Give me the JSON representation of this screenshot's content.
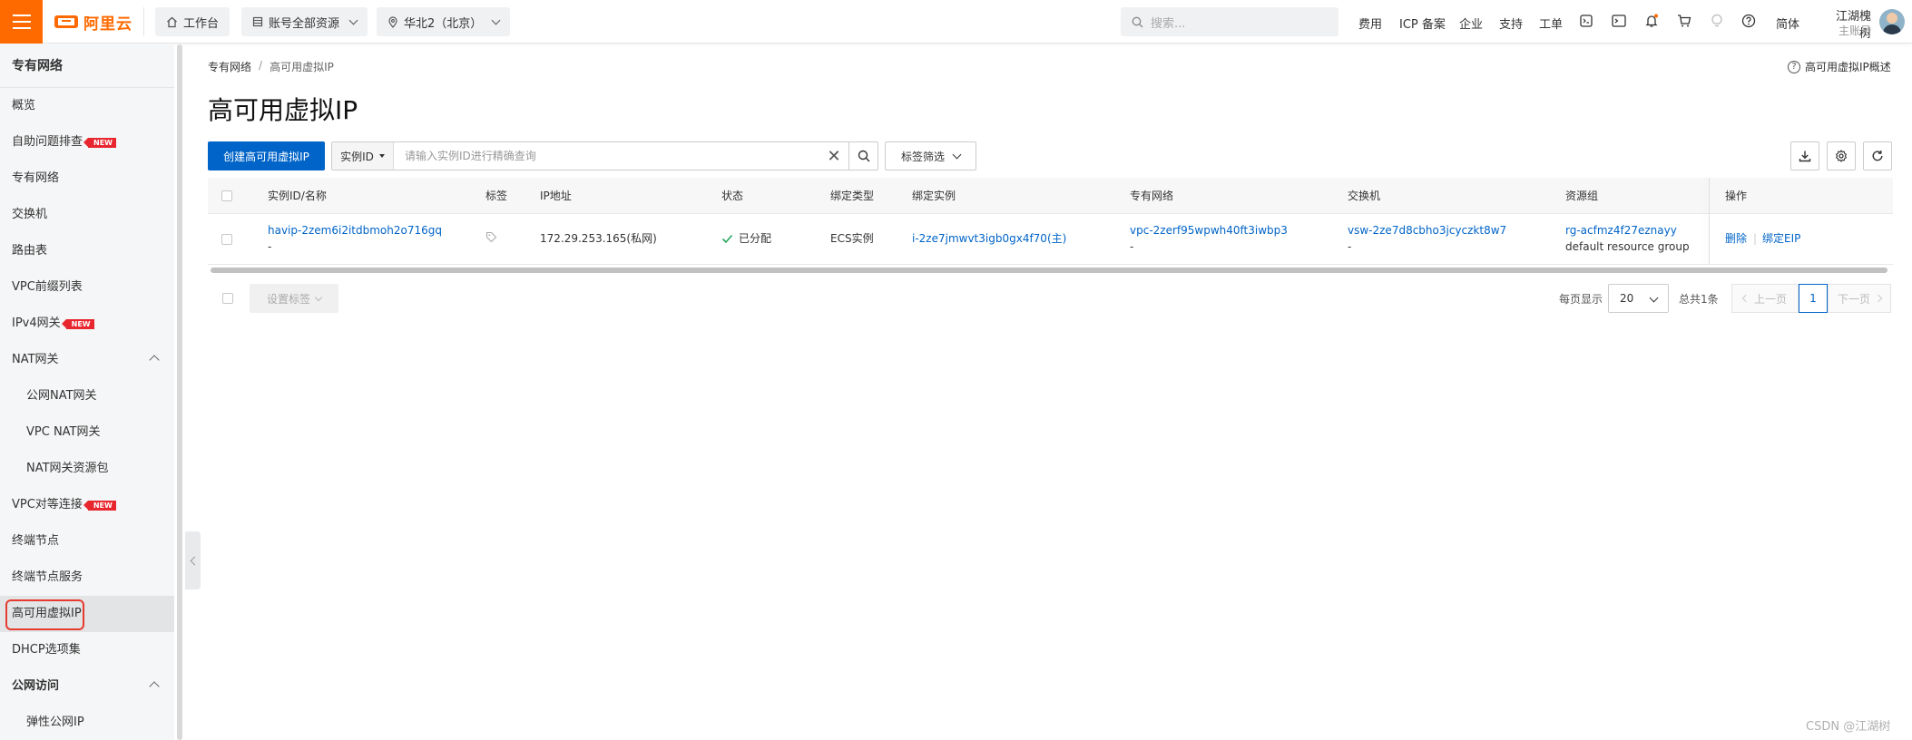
{
  "topbar": {
    "logo_text": "阿里云",
    "workbench": "工作台",
    "resources": "账号全部资源",
    "region": "华北2（北京）",
    "search_placeholder": "搜索...",
    "links": [
      "费用",
      "ICP 备案",
      "企业",
      "支持",
      "工单"
    ],
    "lang": "简体",
    "user_name": "江湖槐树",
    "user_role": "主账号",
    "accent": "#ff6a00"
  },
  "sidebar": {
    "title": "专有网络",
    "items": [
      {
        "label": "概览"
      },
      {
        "label": "自助问题排查",
        "badge": "NEW"
      },
      {
        "label": "专有网络"
      },
      {
        "label": "交换机"
      },
      {
        "label": "路由表"
      },
      {
        "label": "VPC前缀列表"
      },
      {
        "label": "IPv4网关",
        "badge": "NEW"
      },
      {
        "label": "NAT网关"
      },
      {
        "label": "公网NAT网关"
      },
      {
        "label": "VPC NAT网关"
      },
      {
        "label": "NAT网关资源包"
      },
      {
        "label": "VPC对等连接",
        "badge": "NEW"
      },
      {
        "label": "终端节点"
      },
      {
        "label": "终端节点服务"
      },
      {
        "label": "高可用虚拟IP"
      },
      {
        "label": "DHCP选项集"
      },
      {
        "label": "公网访问"
      },
      {
        "label": "弹性公网IP"
      }
    ]
  },
  "breadcrumb": [
    "专有网络",
    "高可用虚拟IP"
  ],
  "help_link": "高可用虚拟IP概述",
  "page_title": "高可用虚拟IP",
  "toolbar": {
    "create_label": "创建高可用虚拟IP",
    "filter_field": "实例ID",
    "filter_placeholder": "请输入实例ID进行精确查询",
    "tag_filter": "标签筛选"
  },
  "table": {
    "headers": [
      "实例ID/名称",
      "标签",
      "IP地址",
      "状态",
      "绑定类型",
      "绑定实例",
      "专有网络",
      "交换机",
      "资源组",
      "操作"
    ],
    "rows": [
      {
        "id": "havip-2zem6i2itdbmoh2o716gq",
        "name": "-",
        "ip": "172.29.253.165(私网)",
        "status": "已分配",
        "bind_type": "ECS实例",
        "bind_instance": "i-2ze7jmwvt3igb0gx4f70(主)",
        "vpc_id": "vpc-2zerf95wpwh40ft3iwbp3",
        "vpc_name": "-",
        "vsw_id": "vsw-2ze7d8cbho3jcyczkt8w7",
        "vsw_name": "-",
        "rg_id": "rg-acfmz4f27eznayy",
        "rg_name": "default resource group",
        "op_delete": "删除",
        "op_bind_eip": "绑定EIP"
      }
    ]
  },
  "footer": {
    "set_tag": "设置标签",
    "page_size_label": "每页显示",
    "page_size": "20",
    "total": "总共1条",
    "prev": "上一页",
    "current_page": "1",
    "next": "下一页"
  },
  "watermark": "CSDN @江湖树"
}
